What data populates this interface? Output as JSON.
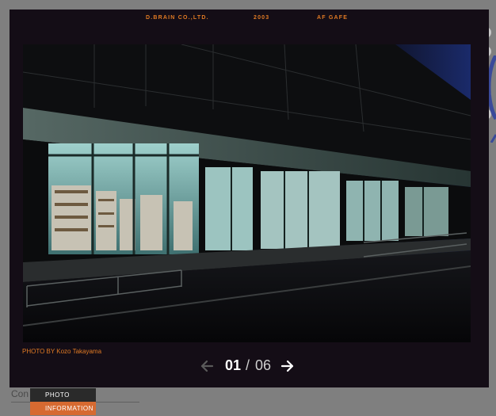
{
  "header": {
    "company": "D.BRAIN CO.,LTD.",
    "year": "2003",
    "project": "AF GAFE"
  },
  "photo": {
    "credit": "PHOTO BY Kozo Takayama"
  },
  "pager": {
    "current": "01",
    "separator": "/",
    "total": "06"
  },
  "background": {
    "partial_text": "Con"
  },
  "menu": {
    "items": [
      {
        "label": "PHOTO"
      },
      {
        "label": "INFORMATION"
      }
    ]
  },
  "colors": {
    "accent": "#e07a24",
    "lightbox_bg": "#140d16",
    "menu_active": "#d66a31"
  }
}
